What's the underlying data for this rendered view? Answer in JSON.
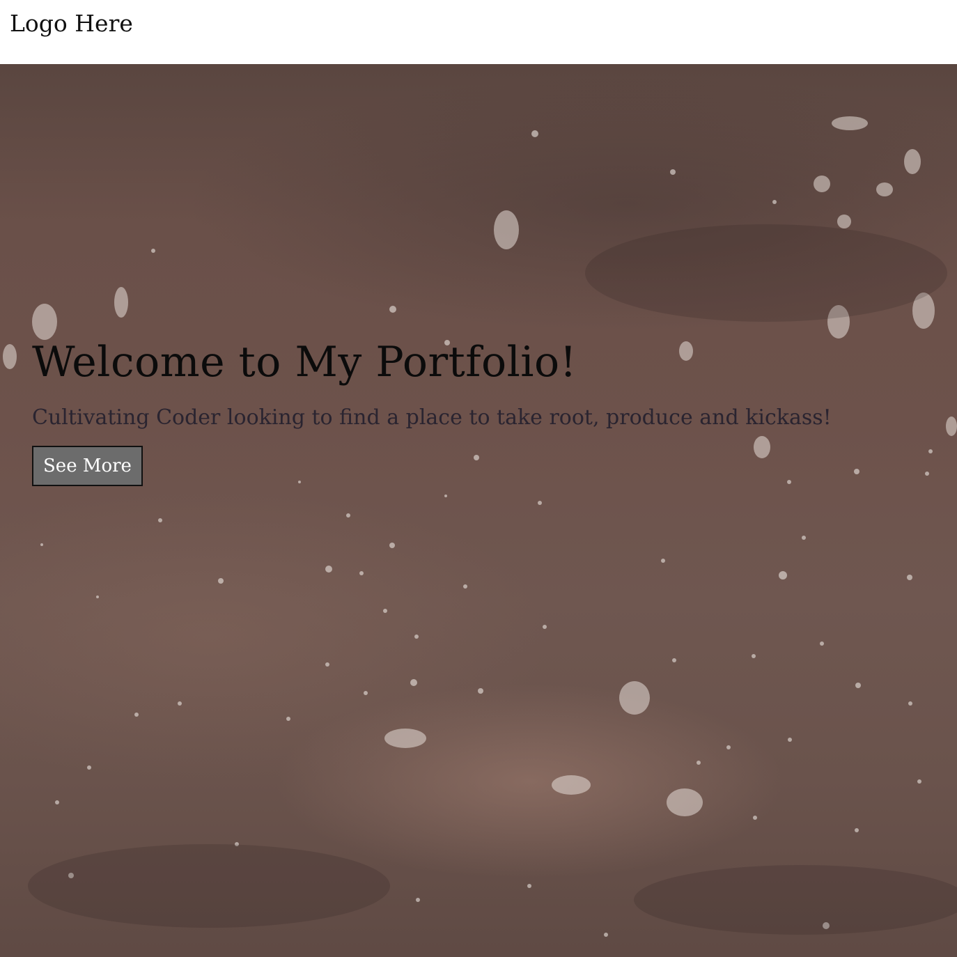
{
  "header": {
    "logo_text": "Logo Here"
  },
  "hero": {
    "title": "Welcome to My Portfolio!",
    "subtitle": "Cultivating Coder looking to find a place to take root, produce and kickass!",
    "button_label": "See More",
    "background_image": "rain-on-puddle-photo"
  },
  "colors": {
    "header_bg": "#ffffff",
    "hero_bg": "#6d524b",
    "title_text": "#0b0b0b",
    "subtitle_text": "#2a2430",
    "button_bg": "#6c6c6c",
    "button_text": "#ffffff",
    "button_border": "#111111"
  }
}
